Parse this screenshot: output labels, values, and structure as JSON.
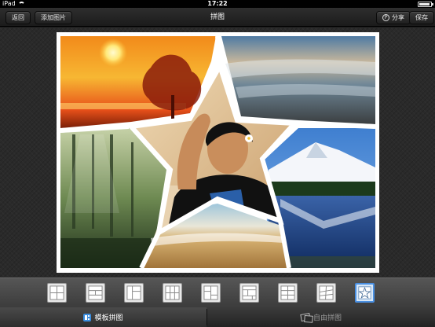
{
  "status_bar": {
    "device": "iPad",
    "time": "17:22",
    "wifi_icon": "wifi-icon",
    "battery_icon": "battery-icon",
    "battery_level": 0.9
  },
  "nav_bar": {
    "back_label": "返回",
    "add_image_label": "添加图片",
    "title": "拼图",
    "share_label": "分享",
    "share_icon": "share-icon",
    "save_label": "保存"
  },
  "collage": {
    "template": "star",
    "background": "#ffffff",
    "cells": [
      {
        "name": "sunset",
        "colors": [
          "#f7b733",
          "#e8501a",
          "#7a1f07"
        ]
      },
      {
        "name": "seashore-waves",
        "colors": [
          "#5a7ea0",
          "#9aa8b3",
          "#4a4e52"
        ]
      },
      {
        "name": "forest",
        "colors": [
          "#a8b58a",
          "#3e5a32",
          "#1e2e1a"
        ]
      },
      {
        "name": "mountain-lake",
        "colors": [
          "#4e8ed6",
          "#ffffff",
          "#1b3a78"
        ]
      },
      {
        "name": "beach",
        "colors": [
          "#9dc3d8",
          "#d8b57a",
          "#a57a3e"
        ]
      },
      {
        "name": "portrait",
        "colors": [
          "#e0c8a0",
          "#b07a4a",
          "#111111"
        ]
      }
    ]
  },
  "template_strip": {
    "selected_index": 8,
    "accent": "#4a90e2",
    "templates": [
      {
        "name": "layout-2x2-a"
      },
      {
        "name": "layout-rows-a"
      },
      {
        "name": "layout-mixed-a"
      },
      {
        "name": "layout-3x3"
      },
      {
        "name": "layout-mixed-b"
      },
      {
        "name": "layout-rows-b"
      },
      {
        "name": "layout-grid-b"
      },
      {
        "name": "layout-diagonal"
      },
      {
        "name": "layout-star"
      }
    ]
  },
  "tabs": {
    "template_label": "模板拼图",
    "template_icon": "grid-layout-icon",
    "free_label": "自由拼图",
    "free_icon": "free-collage-icon",
    "active": "template"
  }
}
